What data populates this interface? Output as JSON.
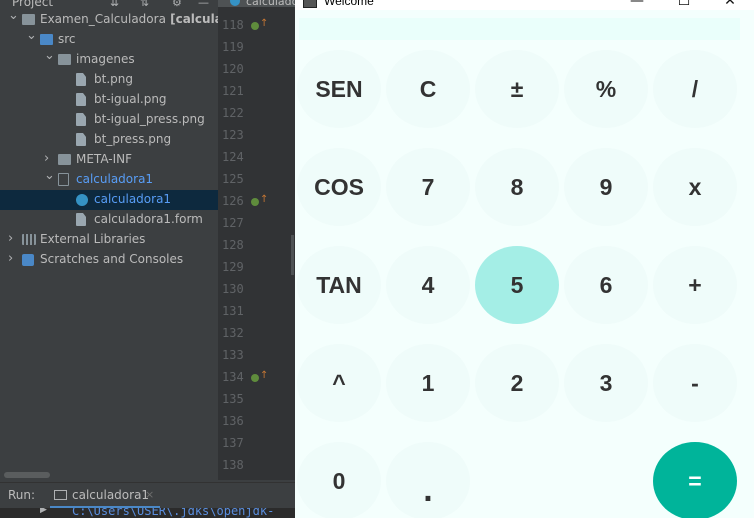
{
  "ide": {
    "project_label": "Project",
    "editor_tab_label": "calculado",
    "tree": [
      {
        "label_main": "Examen_Calculadora",
        "label_bold": " [calculador",
        "icon": "module-icon",
        "level": 0,
        "expanded": true
      },
      {
        "label_main": "src",
        "icon": "source-folder-icon",
        "level": 1,
        "expanded": true
      },
      {
        "label_main": "imagenes",
        "icon": "folder-icon",
        "level": 2,
        "expanded": true
      },
      {
        "label_main": "bt.png",
        "icon": "image-file-icon",
        "level": 3
      },
      {
        "label_main": "bt-igual.png",
        "icon": "image-file-icon",
        "level": 3
      },
      {
        "label_main": "bt-igual_press.png",
        "icon": "image-file-icon",
        "level": 3
      },
      {
        "label_main": "bt_press.png",
        "icon": "image-file-icon",
        "level": 3
      },
      {
        "label_main": "META-INF",
        "icon": "folder-icon",
        "level": 2,
        "expanded": false
      },
      {
        "label_main": "calculadora1",
        "icon": "package-icon",
        "level": 2,
        "expanded": true
      },
      {
        "label_main": "calculadora1",
        "icon": "class-icon",
        "level": 3,
        "selected": true
      },
      {
        "label_main": "calculadora1.form",
        "icon": "form-file-icon",
        "level": 3
      },
      {
        "label_main": "External Libraries",
        "icon": "library-icon",
        "level": 0,
        "expanded": false
      },
      {
        "label_main": "Scratches and Consoles",
        "icon": "scratches-icon",
        "level": 0,
        "expanded": false
      }
    ],
    "line_numbers": [
      "118",
      "119",
      "120",
      "121",
      "122",
      "123",
      "124",
      "125",
      "126",
      "127",
      "128",
      "129",
      "130",
      "131",
      "132",
      "133",
      "134",
      "135",
      "136",
      "137",
      "138"
    ],
    "run": {
      "label": "Run:",
      "tab_label": "calculadora1",
      "close_glyph": "×",
      "console_text": "C:\\Users\\USER\\.jdks\\openjdk-"
    }
  },
  "window": {
    "title": "Welcome",
    "minimize_glyph": "—",
    "maximize_glyph": "☐",
    "close_glyph": "✕",
    "display_value": "",
    "colors": {
      "background": "#f4fffd",
      "key": "#effcfa",
      "key_hover": "#a4eee6",
      "equals": "#00b49a"
    },
    "keys": [
      [
        "SEN",
        "C",
        "±",
        "%",
        "/"
      ],
      [
        "COS",
        "7",
        "8",
        "9",
        "x"
      ],
      [
        "TAN",
        "4",
        "5",
        "6",
        "+"
      ],
      [
        "^",
        "1",
        "2",
        "3",
        "-"
      ],
      [
        "0",
        ".",
        "",
        "",
        "="
      ]
    ],
    "hovered_key": "5"
  }
}
